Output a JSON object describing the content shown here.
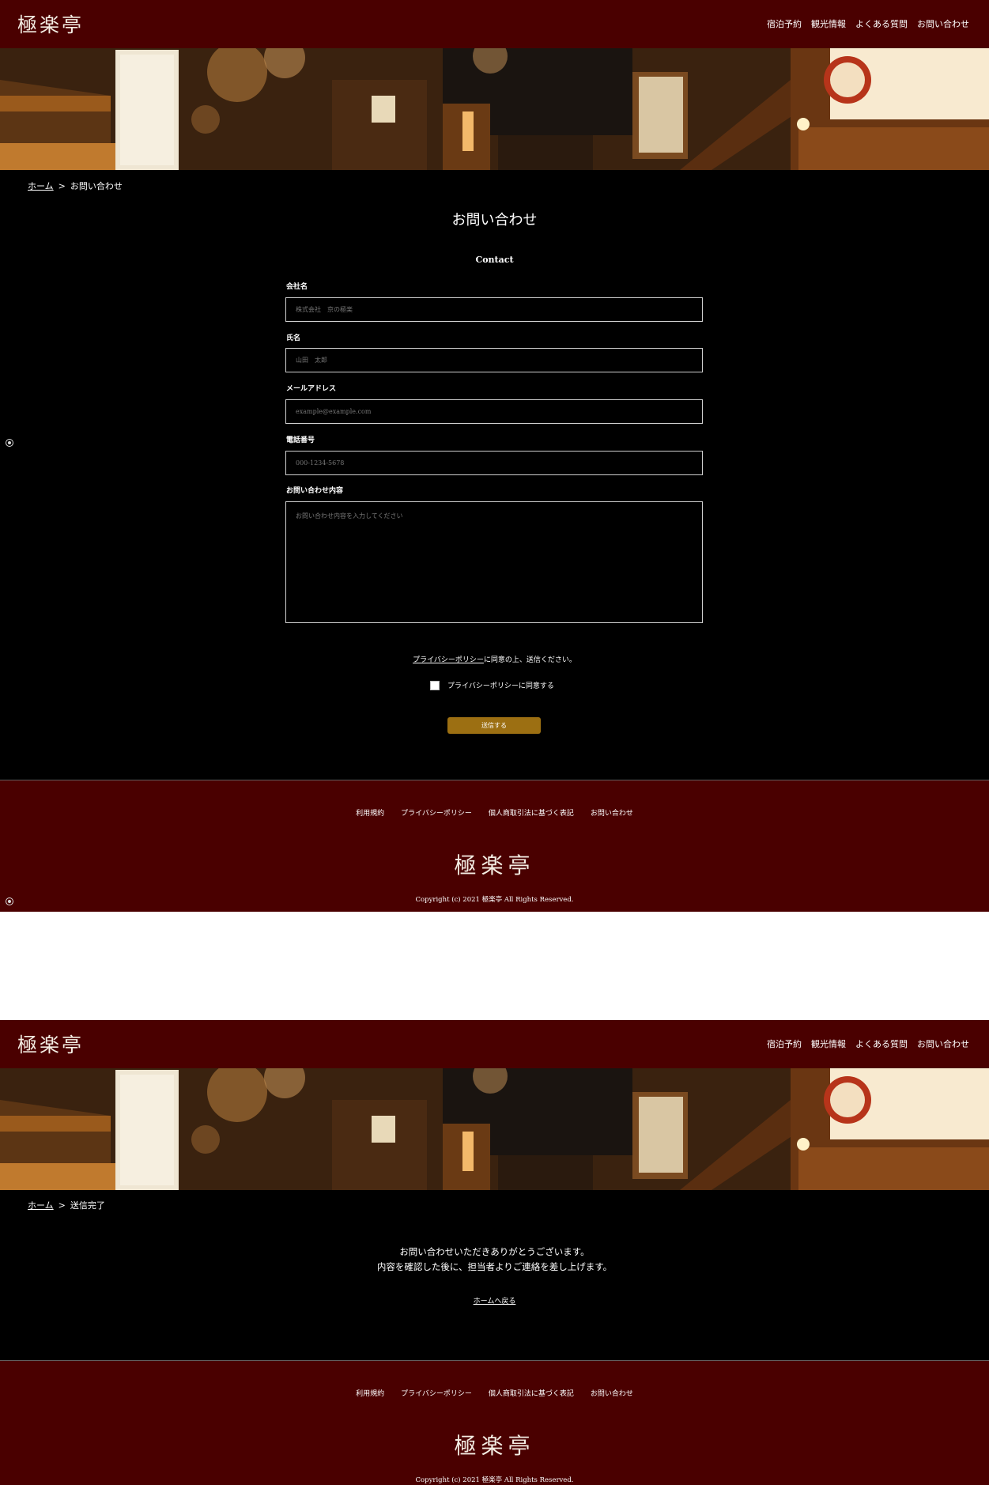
{
  "header": {
    "logo": "極楽亭",
    "nav": [
      "宿泊予約",
      "観光情報",
      "よくある質問",
      "お問い合わせ"
    ]
  },
  "contact_page": {
    "breadcrumb": {
      "home": "ホーム",
      "separator": ">",
      "current": "お問い合わせ"
    },
    "title": "お問い合わせ",
    "subtitle": "Contact",
    "form": {
      "company": {
        "label": "会社名",
        "placeholder": "株式会社　京の極楽"
      },
      "name": {
        "label": "氏名",
        "placeholder": "山田　太郎"
      },
      "email": {
        "label": "メールアドレス",
        "placeholder": "example@example.com"
      },
      "phone": {
        "label": "電話番号",
        "placeholder": "000-1234-5678"
      },
      "message": {
        "label": "お問い合わせ内容",
        "placeholder": "お問い合わせ内容を入力してください"
      }
    },
    "consent_link": "プライバシーポリシー",
    "consent_suffix": "に同意の上、送信ください。",
    "agree_label": "プライバシーポリシーに同意する",
    "agree_checked": false,
    "submit": "送信する"
  },
  "thanks_page": {
    "breadcrumb": {
      "home": "ホーム",
      "separator": ">",
      "current": "送信完了"
    },
    "message_line1": "お問い合わせいただきありがとうございます。",
    "message_line2": "内容を確認した後に、担当者よりご連絡を差し上げます。",
    "home_link": "ホームへ戻る"
  },
  "footer": {
    "nav": [
      "利用規約",
      "プライバシーポリシー",
      "個人商取引法に基づく表記",
      "お問い合わせ"
    ],
    "logo": "極楽亭",
    "copyright": "Copyright (c) 2021 極楽亭 All Rights Reserved."
  },
  "colors": {
    "header_bg": "#4a0000",
    "page_bg": "#000000",
    "accent_button": "#9c6f12"
  },
  "icons": [
    "radio-dot-icon"
  ]
}
